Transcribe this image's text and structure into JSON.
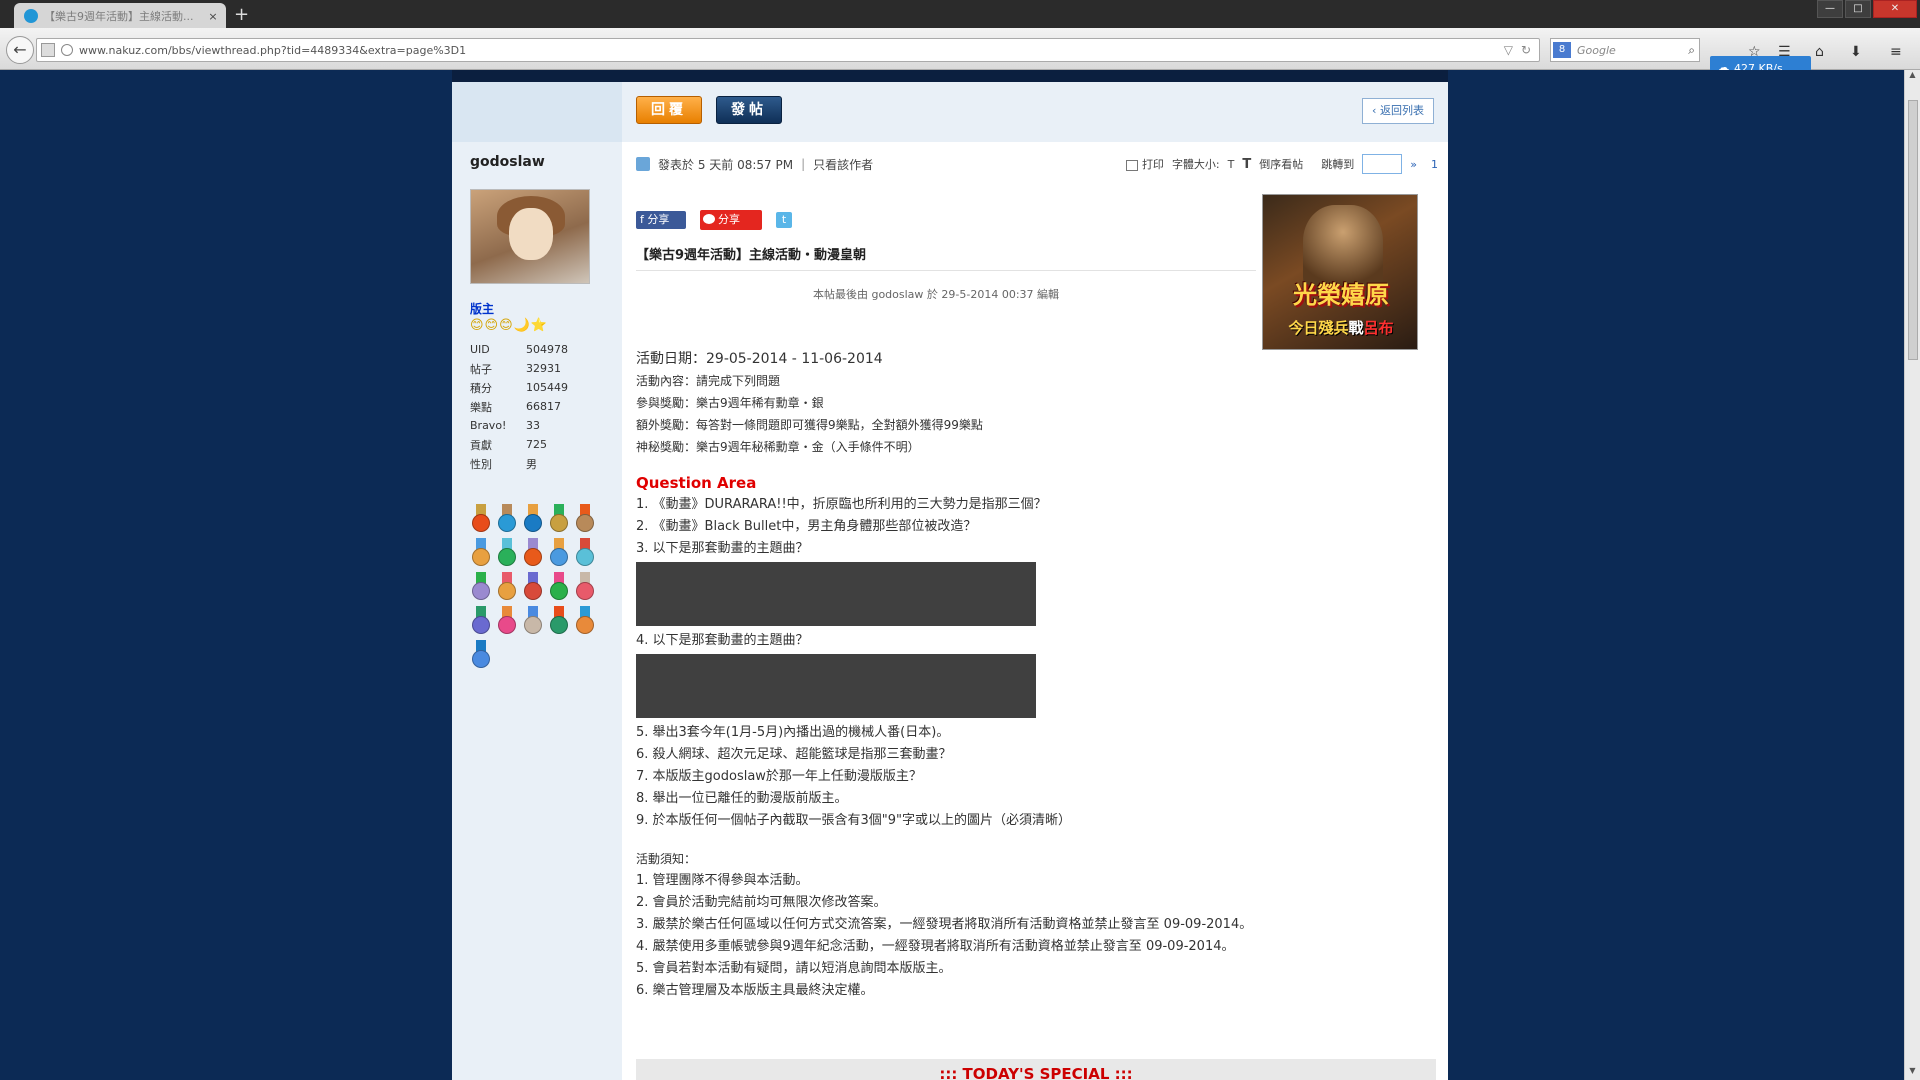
{
  "browser": {
    "tab_title": "【樂古9週年活動】主線活動...",
    "tab_close": "×",
    "new_tab": "+",
    "url": "www.nakuz.com/bbs/viewthread.php?tid=4489334&extra=page%3D1",
    "search_placeholder": "Google",
    "search_engine_badge": "8",
    "download_speed": "427 KB/s",
    "window_controls": {
      "minimize": "—",
      "maximize": "□",
      "close": "✕"
    }
  },
  "toolbar": {
    "reply_label": "回覆",
    "post_label": "發帖",
    "back_to_list": "返回列表"
  },
  "user": {
    "name": "godoslaw",
    "title": "版主",
    "stars": "😊😊😊🌙⭐",
    "stats": [
      {
        "key": "UID",
        "value": "504978"
      },
      {
        "key": "帖子",
        "value": "32931"
      },
      {
        "key": "積分",
        "value": "105449"
      },
      {
        "key": "樂點",
        "value": "66817"
      },
      {
        "key": "Bravo!",
        "value": "33"
      },
      {
        "key": "貢獻",
        "value": "725"
      },
      {
        "key": "性別",
        "value": "男"
      }
    ],
    "medal_colors": [
      "#e84c1a",
      "#2a9ad6",
      "#1a7bc4",
      "#c8a040",
      "#b88a5a",
      "#e8a040",
      "#2ab05a",
      "#e85a1a",
      "#4a9ae0",
      "#5ac0d8",
      "#9a8ad0",
      "#e8a040",
      "#d84a3a",
      "#2ab04a",
      "#e85a6a",
      "#6a6ad0",
      "#e84a8a",
      "#c8b8a8",
      "#2a9a6a",
      "#e88a3a",
      "#4a8ae0"
    ]
  },
  "post": {
    "meta_posted": "發表於 5 天前 08:57 PM",
    "meta_author_only": "只看該作者",
    "print": "打印",
    "font_size_label": "字體大小:",
    "font_size_value": "T",
    "reverse_label": "倒序看帖",
    "jump_label": "跳轉到",
    "jump_arrow": "»",
    "floor": "1",
    "share_fb": "分享",
    "share_weibo": "分享",
    "share_twitter": "t",
    "title": "【樂古9週年活動】主線活動・動漫皇朝",
    "edit_note": "本帖最後由 godoslaw 於 29-5-2014 00:37 編輯",
    "info": {
      "date_line": "活動日期：29-05-2014 - 11-06-2014",
      "content_line": "活動內容：請完成下列問題",
      "reward_line": "參與獎勵：樂古9週年稀有勳章・銀",
      "extra_line": "額外獎勵：每答對一條問題即可獲得9樂點，全對額外獲得99樂點",
      "secret_line": "神秘獎勵：樂古9週年秘稀勳章・金（入手條件不明）"
    },
    "qa_heading": "Question Area",
    "questions": [
      "1. 《動畫》DURARARA!!中，折原臨也所利用的三大勢力是指那三個？",
      "2. 《動畫》Black Bullet中，男主角身體那些部位被改造？",
      "3. 以下是那套動畫的主題曲？",
      "4. 以下是那套動畫的主題曲？",
      "5. 舉出3套今年(1月-5月)內播出過的機械人番(日本)。",
      "6. 殺人網球、超次元足球、超能籃球是指那三套動畫？",
      "7. 本版版主godoslaw於那一年上任動漫版版主？",
      "8. 舉出一位已離任的動漫版前版主。",
      "9. 於本版任何一個帖子內截取一張含有3個\"9\"字或以上的圖片（必須清晰）"
    ],
    "notice_heading": "活動須知：",
    "notices": [
      "1. 管理團隊不得參與本活動。",
      "2. 會員於活動完結前均可無限次修改答案。",
      "3. 嚴禁於樂古任何區域以任何方式交流答案，一經發現者將取消所有活動資格並禁止發言至 09-09-2014。",
      "4. 嚴禁使用多重帳號參與9週年紀念活動，一經發現者將取消所有活動資格並禁止發言至 09-09-2014。",
      "5. 會員若對本活動有疑問，請以短消息詢問本版版主。",
      "6. 樂古管理層及本版版主具最終決定權。"
    ],
    "special_bar": "::: TODAY'S SPECIAL :::"
  },
  "ad": {
    "headline": "光榮嬉原",
    "tagline_a": "今日",
    "tagline_b": "殘兵",
    "tagline_c": "戰",
    "tagline_d": "呂布"
  }
}
